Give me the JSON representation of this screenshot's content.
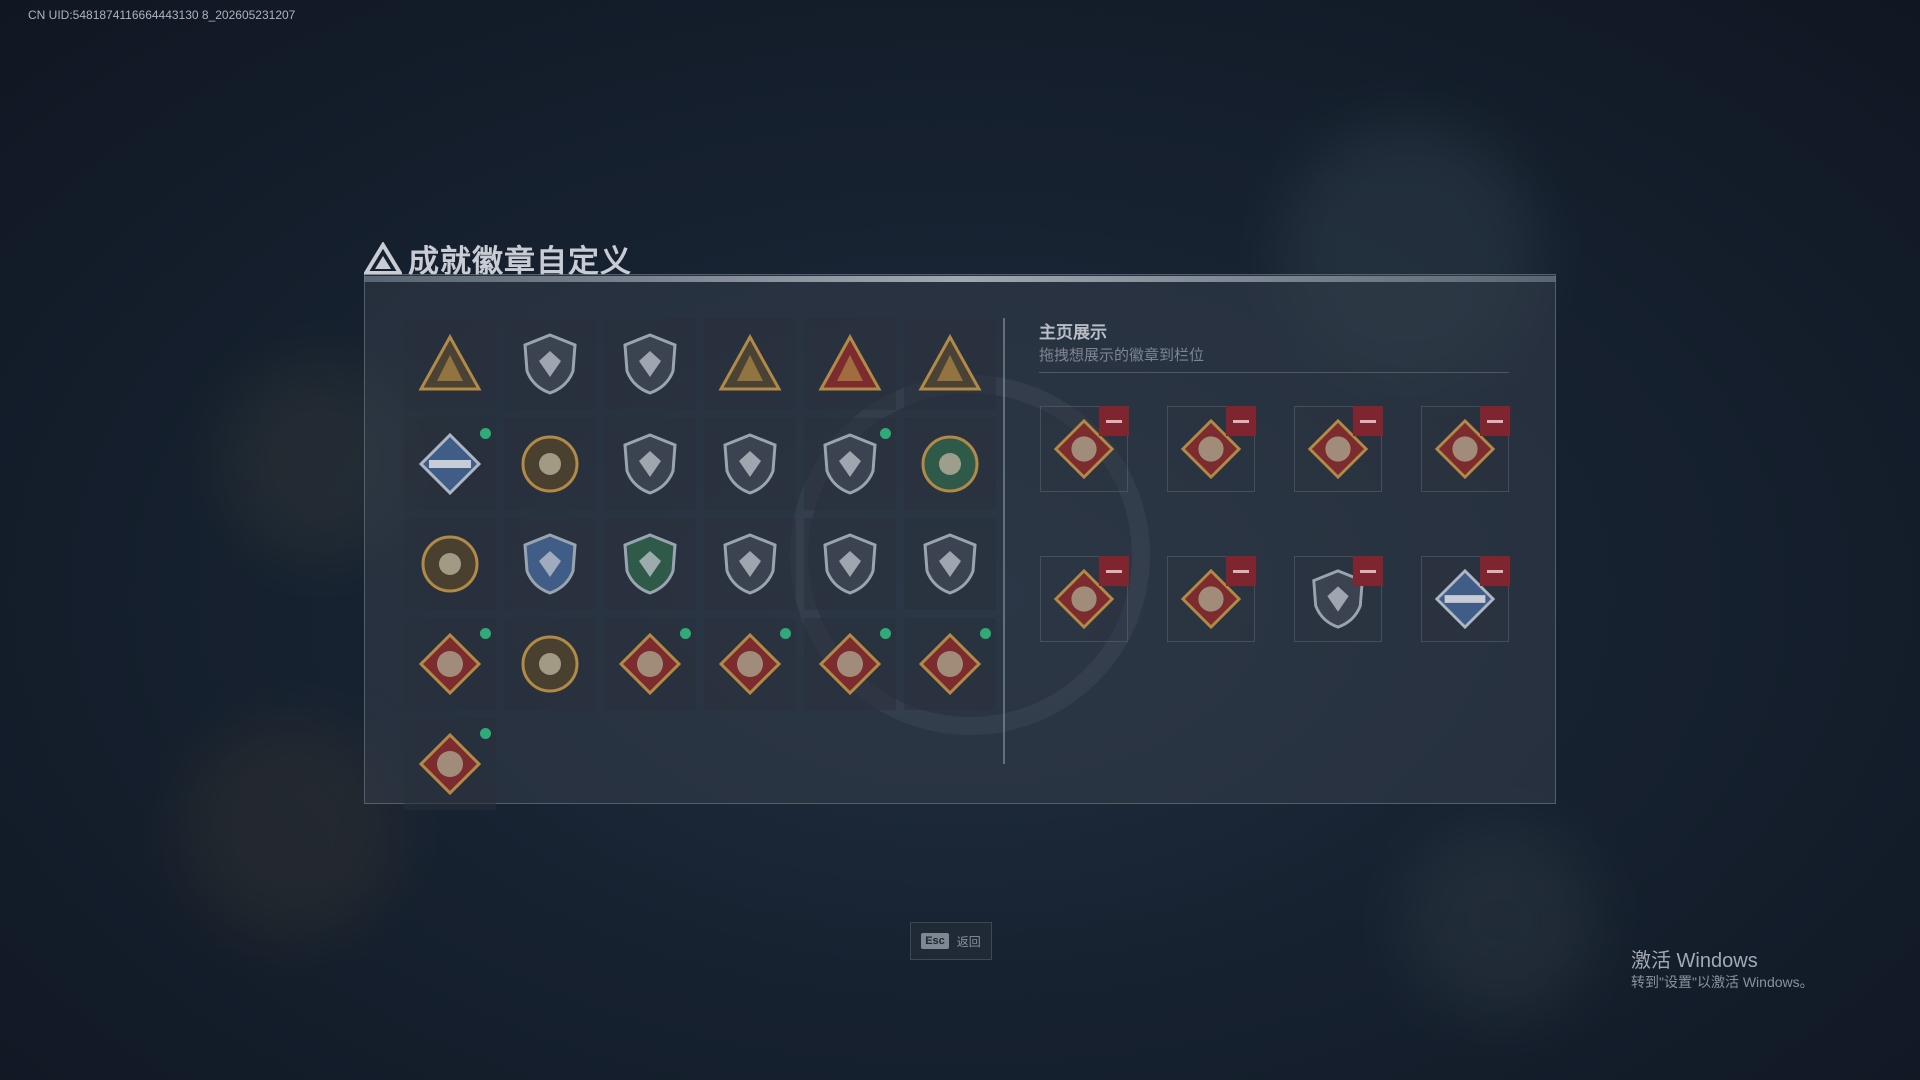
{
  "uid_text": "CN UID:5481874116664443130 8_202605231207",
  "page_title": "成就徽章自定义",
  "colors": {
    "accent_green": "#2faa78",
    "remove_red": "#7e2530",
    "badge_gold": "#b08a46",
    "badge_red": "#7c2b2f",
    "badge_blue": "#3f5d86"
  },
  "collection": {
    "items": [
      {
        "icon": "triangle-shield-badge",
        "new": false
      },
      {
        "icon": "helicopter-badge",
        "new": false
      },
      {
        "icon": "jet-shield-badge",
        "new": false
      },
      {
        "icon": "gold-triangle-badge",
        "new": false
      },
      {
        "icon": "number-one-badge",
        "new": false
      },
      {
        "icon": "soldiers-badge",
        "new": false
      },
      {
        "icon": "rocket-launcher-badge",
        "new": true
      },
      {
        "icon": "star-medal-badge",
        "new": false
      },
      {
        "icon": "shield-plane-badge",
        "new": false
      },
      {
        "icon": "winged-medal-badge",
        "new": false
      },
      {
        "icon": "lion-shield-badge",
        "new": true
      },
      {
        "icon": "skull-target-badge",
        "new": false
      },
      {
        "icon": "fist-emblem-badge",
        "new": false
      },
      {
        "icon": "blue-crosshair-shield-badge",
        "new": false
      },
      {
        "icon": "green-crosshair-shield-badge",
        "new": false
      },
      {
        "icon": "rifle-shield-badge",
        "new": false
      },
      {
        "icon": "rifle-shield-badge-2",
        "new": false
      },
      {
        "icon": "crossed-rifles-gold-badge",
        "new": false
      },
      {
        "icon": "wolf-head-badge",
        "new": true
      },
      {
        "icon": "hornet-hex-badge",
        "new": false
      },
      {
        "icon": "dragon-head-badge",
        "new": true
      },
      {
        "icon": "dragon-head-badge-2",
        "new": true
      },
      {
        "icon": "runner-badge",
        "new": true
      },
      {
        "icon": "dinosaur-head-badge",
        "new": true
      },
      {
        "icon": "wheel-badge",
        "new": true
      }
    ]
  },
  "showcase": {
    "title": "主页展示",
    "subtitle": "拖拽想展示的徽章到栏位",
    "slots": [
      {
        "icon": "wheel-badge"
      },
      {
        "icon": "dinosaur-head-badge"
      },
      {
        "icon": "wolf-head-badge"
      },
      {
        "icon": "dragon-head-badge"
      },
      {
        "icon": "dragon-head-badge-2"
      },
      {
        "icon": "runner-badge"
      },
      {
        "icon": "lion-shield-badge"
      },
      {
        "icon": "rocket-launcher-badge"
      }
    ]
  },
  "esc": {
    "key": "Esc",
    "label": "返回"
  },
  "windows_notice": {
    "title": "激活 Windows",
    "subtitle": "转到\"设置\"以激活 Windows。"
  }
}
